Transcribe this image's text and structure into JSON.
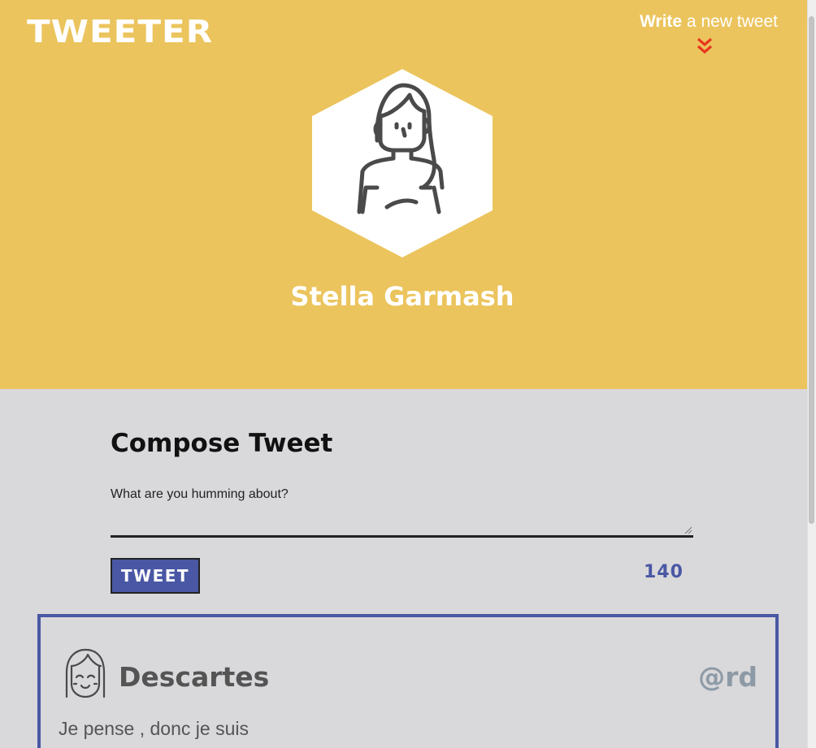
{
  "header": {
    "logo": "TWEETER",
    "write_link": {
      "bold": "Write",
      "rest": " a new tweet"
    },
    "user_name": "Stella Garmash",
    "avatar_icon": "woman-avatar-icon",
    "background": "#ebc45d"
  },
  "compose": {
    "title": "Compose Tweet",
    "placeholder": "What are you humming about?",
    "button_label": "TWEET",
    "counter": "140"
  },
  "tweets": [
    {
      "author": "Descartes",
      "handle": "@rd",
      "text": "Je pense , donc je suis",
      "avatar_icon": "smiling-girl-avatar-icon"
    }
  ],
  "colors": {
    "accent": "#4a57a4",
    "arrow": "#e8371f",
    "page_bg": "#d9d8db"
  }
}
